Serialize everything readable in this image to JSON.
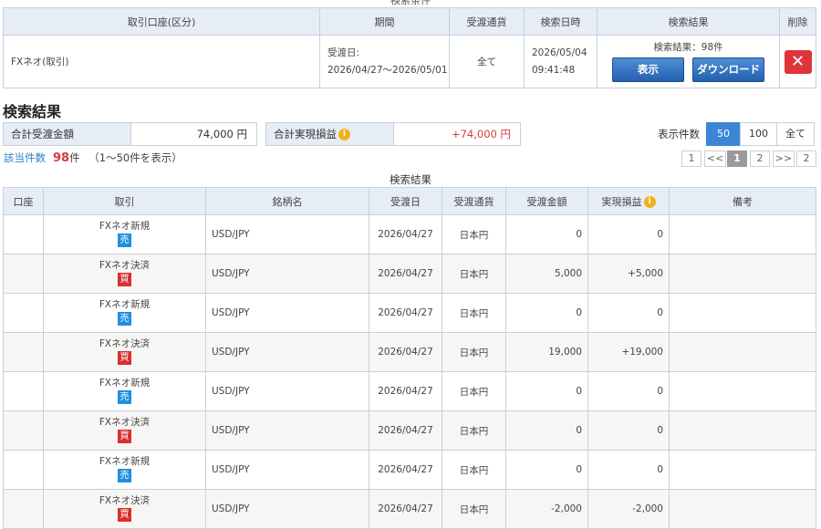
{
  "search_conditions": {
    "caption": "検索条件",
    "headers": [
      "取引口座(区分)",
      "期間",
      "受渡通貨",
      "検索日時",
      "検索結果",
      "削除"
    ],
    "account": "FXネオ(取引)",
    "period_label": "受渡日:",
    "period_range": "2026/04/27〜2026/05/01",
    "currency": "全て",
    "search_date": "2026/05/04",
    "search_time": "09:41:48",
    "result_text": "検索結果：98件",
    "show_button": "表示",
    "download_button": "ダウンロード",
    "delete_symbol": "✕"
  },
  "results": {
    "title": "検索結果",
    "total_delivery_label": "合計受渡金額",
    "total_delivery_value": "74,000 円",
    "total_pl_label": "合計実現損益",
    "total_pl_value": "+74,000 円",
    "info_symbol": "i",
    "display_count_label": "表示件数",
    "display_count_options": [
      "50",
      "100",
      "全て"
    ],
    "display_count_selected": "50",
    "hits_label": "該当件数",
    "hits_count": "98",
    "hits_unit": "件",
    "hits_range": "（1〜50件を表示）",
    "pagination": [
      "1",
      "<<",
      "1",
      "2",
      ">>",
      "2"
    ],
    "table_caption": "検索結果",
    "columns": [
      "口座",
      "取引",
      "銘柄名",
      "受渡日",
      "受渡通貨",
      "受渡金額",
      "実現損益",
      "備考"
    ]
  },
  "rows": [
    {
      "trade": "FXネオ新規",
      "side": "売",
      "side_color": "#1e90e0",
      "symbol": "USD/JPY",
      "date": "2026/04/27",
      "currency": "日本円",
      "amount": "0",
      "pl": "0",
      "pl_type": ""
    },
    {
      "trade": "FXネオ決済",
      "side": "買",
      "side_color": "#d9302c",
      "symbol": "USD/JPY",
      "date": "2026/04/27",
      "currency": "日本円",
      "amount": "5,000",
      "pl": "+5,000",
      "pl_type": "pos"
    },
    {
      "trade": "FXネオ新規",
      "side": "売",
      "side_color": "#1e90e0",
      "symbol": "USD/JPY",
      "date": "2026/04/27",
      "currency": "日本円",
      "amount": "0",
      "pl": "0",
      "pl_type": ""
    },
    {
      "trade": "FXネオ決済",
      "side": "買",
      "side_color": "#d9302c",
      "symbol": "USD/JPY",
      "date": "2026/04/27",
      "currency": "日本円",
      "amount": "19,000",
      "pl": "+19,000",
      "pl_type": "pos"
    },
    {
      "trade": "FXネオ新規",
      "side": "売",
      "side_color": "#1e90e0",
      "symbol": "USD/JPY",
      "date": "2026/04/27",
      "currency": "日本円",
      "amount": "0",
      "pl": "0",
      "pl_type": ""
    },
    {
      "trade": "FXネオ決済",
      "side": "買",
      "side_color": "#d9302c",
      "symbol": "USD/JPY",
      "date": "2026/04/27",
      "currency": "日本円",
      "amount": "0",
      "pl": "0",
      "pl_type": ""
    },
    {
      "trade": "FXネオ新規",
      "side": "売",
      "side_color": "#1e90e0",
      "symbol": "USD/JPY",
      "date": "2026/04/27",
      "currency": "日本円",
      "amount": "0",
      "pl": "0",
      "pl_type": ""
    },
    {
      "trade": "FXネオ決済",
      "side": "買",
      "side_color": "#d9302c",
      "symbol": "USD/JPY",
      "date": "2026/04/27",
      "currency": "日本円",
      "amount": "-2,000",
      "pl": "-2,000",
      "pl_type": "neg",
      "amount_type": "neg"
    }
  ]
}
